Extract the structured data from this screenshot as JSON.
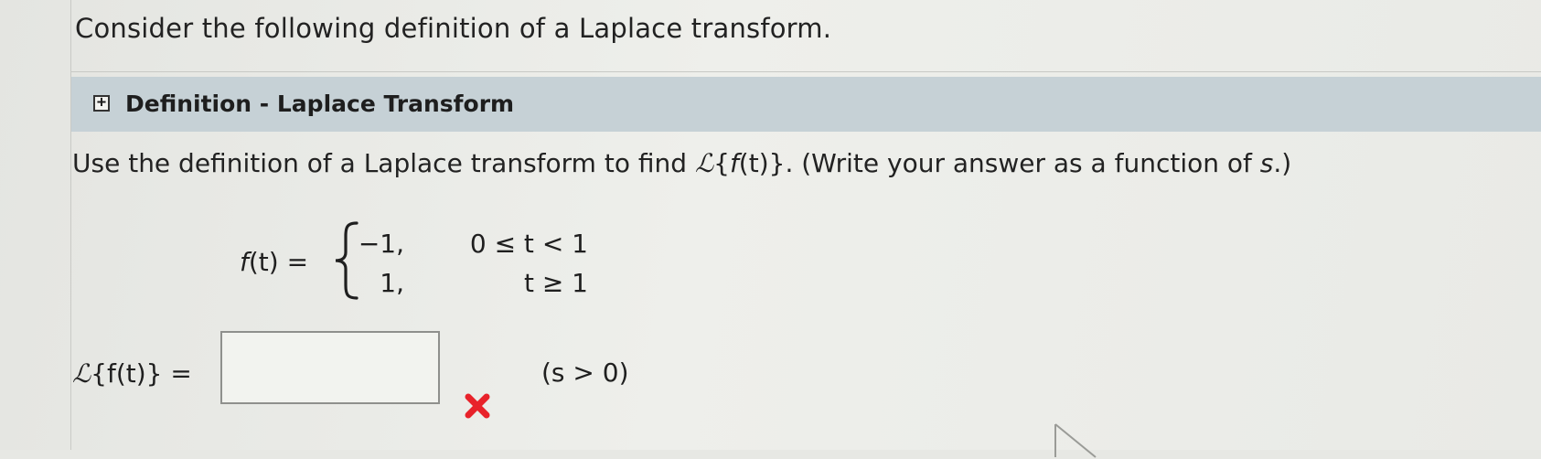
{
  "intro_text": "Consider the following definition of a Laplace transform.",
  "definition": {
    "toggle_symbol": "+",
    "title": "Definition - Laplace Transform"
  },
  "question": {
    "prefix": "Use the definition of a Laplace transform to find ",
    "laplace_symbol": "ℒ",
    "expr_open": "{",
    "expr_f": "f",
    "expr_t": "(t)",
    "expr_close": "}",
    "suffix": ". (Write your answer as a function of ",
    "var": "s",
    "suffix_end": ".)"
  },
  "function": {
    "label_f": "f",
    "label_rest": "(t) =",
    "cases": [
      {
        "value": "−1,",
        "condition": "0 ≤ t < 1"
      },
      {
        "value": "1,",
        "condition": "t ≥ 1"
      }
    ]
  },
  "answer": {
    "label_L": "ℒ",
    "label_rest": "{f(t)} =",
    "input_value": "",
    "status": "incorrect",
    "status_color": "#e8222a",
    "status_icon": "x-mark-icon",
    "condition_text": "(s > 0)"
  }
}
